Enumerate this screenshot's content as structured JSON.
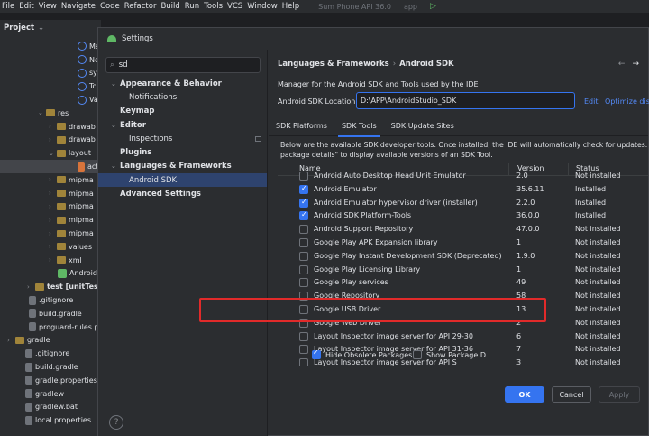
{
  "menubar": {
    "items": [
      "File",
      "Edit",
      "View",
      "Navigate",
      "Code",
      "Refactor",
      "Build",
      "Run",
      "Tools",
      "VCS",
      "Window",
      "Help"
    ],
    "device": "Sum Phone API 36.0",
    "app": "app"
  },
  "project": {
    "title": "Project",
    "rows": [
      {
        "label": "Mai",
        "icon": "class"
      },
      {
        "label": "Nev",
        "icon": "class"
      },
      {
        "label": "syst",
        "icon": "class"
      },
      {
        "label": "Tok",
        "icon": "class"
      },
      {
        "label": "Valu",
        "icon": "class"
      },
      {
        "label": "res",
        "icon": "folder"
      },
      {
        "label": "drawab",
        "icon": "folder"
      },
      {
        "label": "drawab",
        "icon": "folder"
      },
      {
        "label": "layout",
        "icon": "folder"
      },
      {
        "label": "acti",
        "icon": "xml"
      },
      {
        "label": "mipma",
        "icon": "folder"
      },
      {
        "label": "mipma",
        "icon": "folder"
      },
      {
        "label": "mipma",
        "icon": "folder"
      },
      {
        "label": "mipma",
        "icon": "folder"
      },
      {
        "label": "mipma",
        "icon": "folder"
      },
      {
        "label": "values",
        "icon": "folder"
      },
      {
        "label": "xml",
        "icon": "folder"
      },
      {
        "label": "AndroidM",
        "icon": "module"
      },
      {
        "label": "test [unitTes",
        "icon": "folder"
      },
      {
        "label": ".gitignore",
        "icon": "file"
      },
      {
        "label": "build.gradle",
        "icon": "file"
      },
      {
        "label": "proguard-rules.p",
        "icon": "file"
      },
      {
        "label": "gradle",
        "icon": "folder"
      },
      {
        "label": ".gitignore",
        "icon": "file"
      },
      {
        "label": "build.gradle",
        "icon": "file"
      },
      {
        "label": "gradle.properties",
        "icon": "file"
      },
      {
        "label": "gradlew",
        "icon": "file"
      },
      {
        "label": "gradlew.bat",
        "icon": "file"
      },
      {
        "label": "local.properties",
        "icon": "file"
      }
    ]
  },
  "dialog": {
    "title": "Settings",
    "search": {
      "value": "sd"
    },
    "tree": [
      {
        "label": "Appearance & Behavior",
        "bold": true,
        "level": 0,
        "expanded": true
      },
      {
        "label": "Notifications",
        "bold": false,
        "level": 1
      },
      {
        "label": "Keymap",
        "bold": true,
        "level": 0
      },
      {
        "label": "Editor",
        "bold": true,
        "level": 0,
        "expanded": true
      },
      {
        "label": "Inspections",
        "bold": false,
        "level": 1
      },
      {
        "label": "Plugins",
        "bold": true,
        "level": 0
      },
      {
        "label": "Languages & Frameworks",
        "bold": true,
        "level": 0,
        "expanded": true
      },
      {
        "label": "Android SDK",
        "bold": false,
        "level": 1,
        "selected": true
      },
      {
        "label": "Advanced Settings",
        "bold": true,
        "level": 0
      }
    ],
    "breadcrumb": [
      "Languages & Frameworks",
      "Android SDK"
    ],
    "description": "Manager for the Android SDK and Tools used by the IDE",
    "sdk_location": {
      "label": "Android SDK Location:",
      "value": "D:\\APP\\AndroidStudio_SDK",
      "edit": "Edit",
      "optimize": "Optimize disk"
    },
    "tabs": [
      "SDK Platforms",
      "SDK Tools",
      "SDK Update Sites"
    ],
    "active_tab": "SDK Tools",
    "info_line1": "Below are the available SDK developer tools. Once installed, the IDE will automatically check for updates. Check \"",
    "info_line2": "package details\" to display available versions of an SDK Tool.",
    "columns": {
      "name": "Name",
      "version": "Version",
      "status": "Status"
    },
    "rows": [
      {
        "name": "Android Auto Desktop Head Unit Emulator",
        "version": "2.0",
        "status": "Not installed",
        "checked": false
      },
      {
        "name": "Android Emulator",
        "version": "35.6.11",
        "status": "Installed",
        "checked": true
      },
      {
        "name": "Android Emulator hypervisor driver (installer)",
        "version": "2.2.0",
        "status": "Installed",
        "checked": true
      },
      {
        "name": "Android SDK Platform-Tools",
        "version": "36.0.0",
        "status": "Installed",
        "checked": true
      },
      {
        "name": "Android Support Repository",
        "version": "47.0.0",
        "status": "Not installed",
        "checked": false
      },
      {
        "name": "Google Play APK Expansion library",
        "version": "1",
        "status": "Not installed",
        "checked": false
      },
      {
        "name": "Google Play Instant Development SDK (Deprecated)",
        "version": "1.9.0",
        "status": "Not installed",
        "checked": false
      },
      {
        "name": "Google Play Licensing Library",
        "version": "1",
        "status": "Not installed",
        "checked": false
      },
      {
        "name": "Google Play services",
        "version": "49",
        "status": "Not installed",
        "checked": false
      },
      {
        "name": "Google Repository",
        "version": "58",
        "status": "Not installed",
        "checked": false
      },
      {
        "name": "Google USB Driver",
        "version": "13",
        "status": "Not installed",
        "checked": false
      },
      {
        "name": "Google Web Driver",
        "version": "2",
        "status": "Not installed",
        "checked": false
      },
      {
        "name": "Layout Inspector image server for API 29-30",
        "version": "6",
        "status": "Not installed",
        "checked": false
      },
      {
        "name": "Layout Inspector image server for API 31-36",
        "version": "7",
        "status": "Not installed",
        "checked": false
      },
      {
        "name": "Layout Inspector image server for API S",
        "version": "3",
        "status": "Not installed",
        "checked": false
      }
    ],
    "hide_obsolete": "Hide Obsolete Packages",
    "show_package": "Show Package D",
    "buttons": {
      "ok": "OK",
      "cancel": "Cancel",
      "apply": "Apply"
    },
    "help": "?"
  },
  "colors": {
    "accent": "#3574f0",
    "highlight_box": "#e12a2a",
    "link": "#548af7"
  }
}
